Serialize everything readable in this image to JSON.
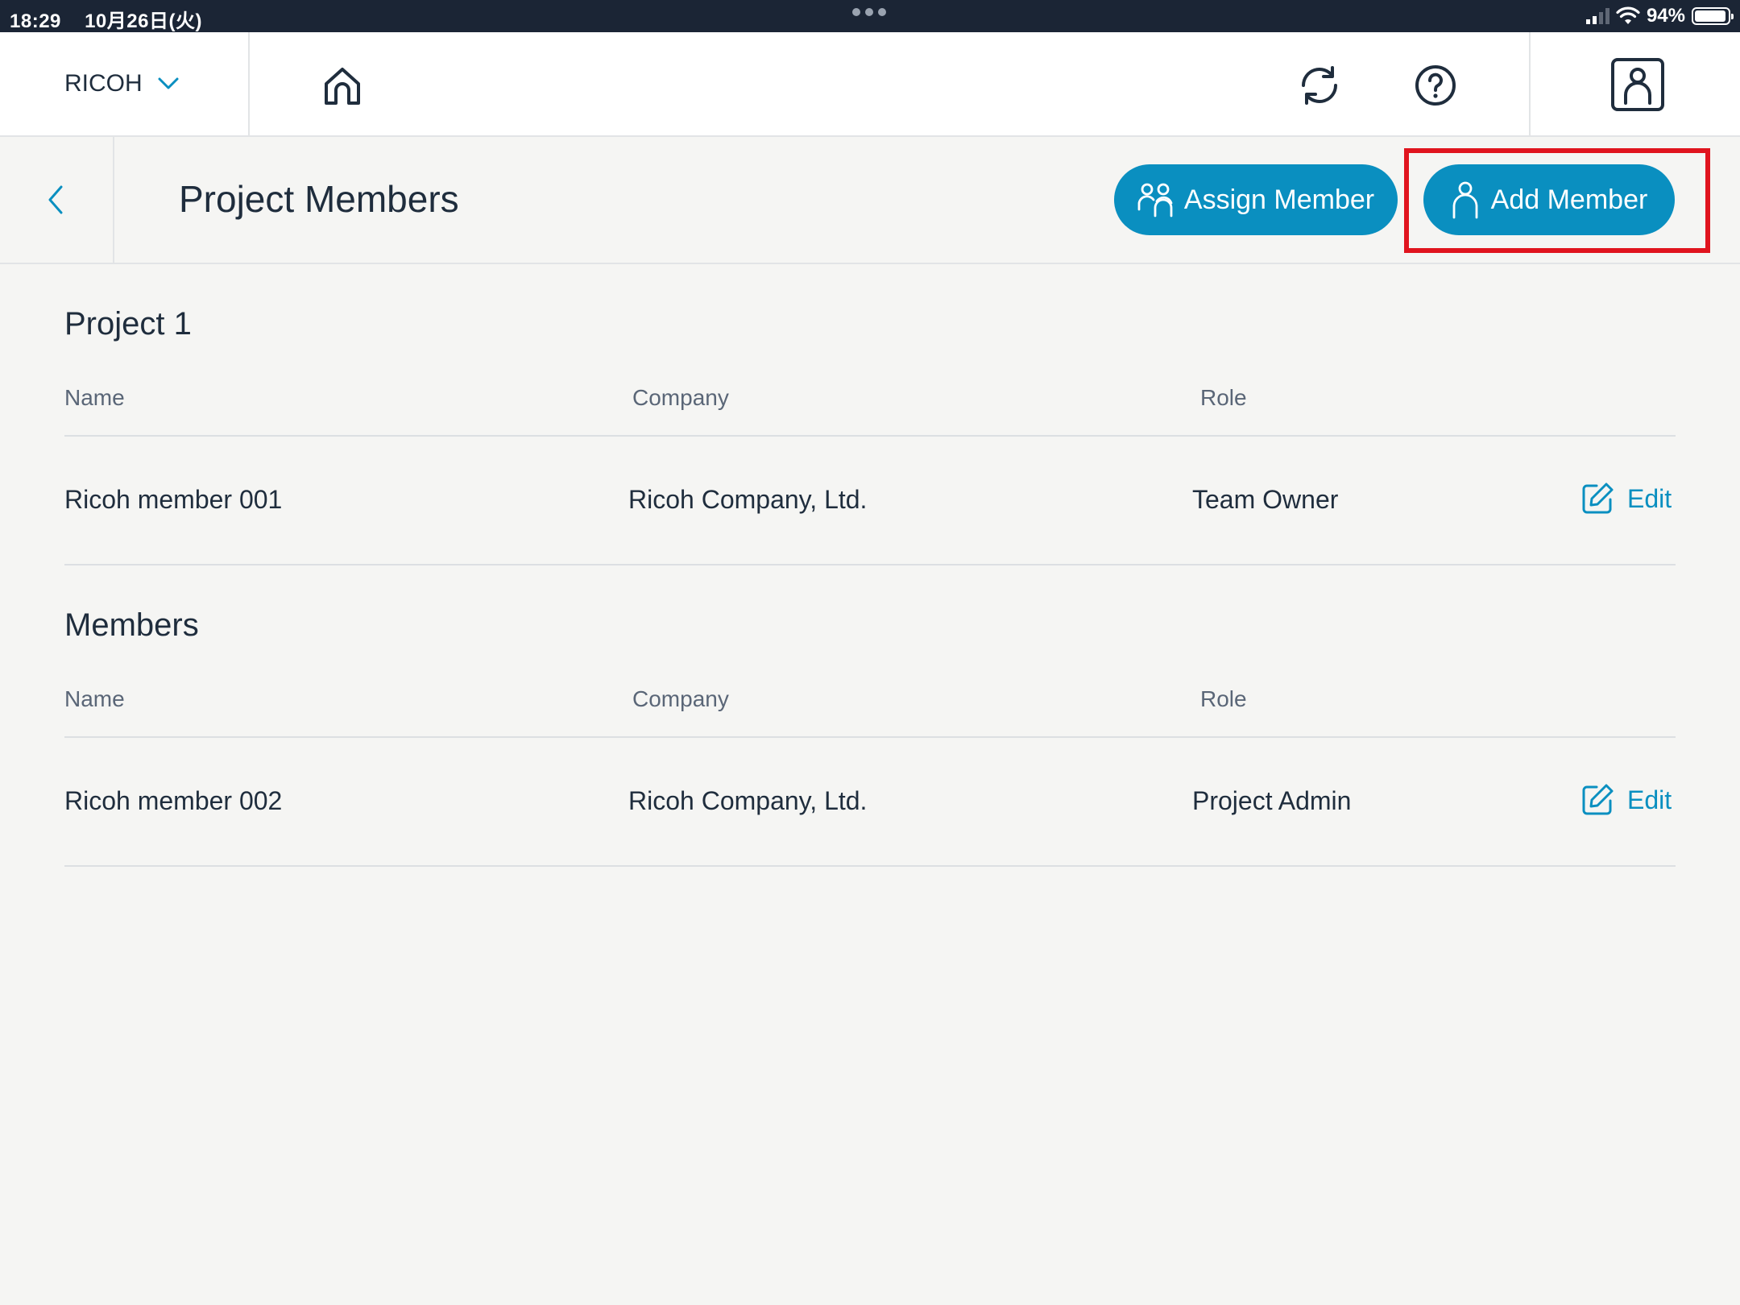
{
  "status_bar": {
    "time": "18:29",
    "date": "10月26日(火)",
    "battery": "94%",
    "battery_level": 0.94
  },
  "app_bar": {
    "org_name": "RICOH",
    "icons": [
      "chevron-down-icon",
      "home-icon",
      "sync-icon",
      "help-icon",
      "profile-icon"
    ]
  },
  "header": {
    "title": "Project Members",
    "assign_button": "Assign Member",
    "add_button": "Add Member"
  },
  "colors": {
    "accent": "#0a8fc0",
    "highlight": "#e0141e",
    "status_bar": "#1b2535"
  },
  "sections": [
    {
      "title": "Project 1",
      "columns": [
        "Name",
        "Company",
        "Role"
      ],
      "rows": [
        {
          "name": "Ricoh member 001",
          "company": "Ricoh Company, Ltd.",
          "role": "Team Owner",
          "action": "Edit"
        }
      ]
    },
    {
      "title": "Members",
      "columns": [
        "Name",
        "Company",
        "Role"
      ],
      "rows": [
        {
          "name": "Ricoh member 002",
          "company": "Ricoh Company, Ltd.",
          "role": "Project Admin",
          "action": "Edit"
        }
      ]
    }
  ]
}
